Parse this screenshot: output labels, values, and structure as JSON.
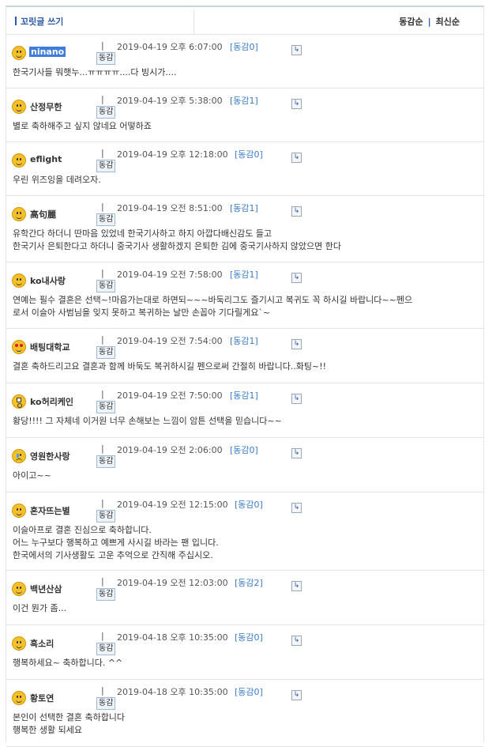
{
  "header": {
    "title": "꼬릿글 쓰기",
    "sort_by_votes": "동감순",
    "sort_by_latest": "최신순"
  },
  "vote_button_label": "동감",
  "reply_icon": "reply-arrow-icon",
  "comments": [
    {
      "nick": "ninano",
      "date": "2019-04-19 오후 6:07:00",
      "vote": "[동감0]",
      "text": "한국기사들 뭐햇누...ㅠㅠㅠㅠ....다 빙시가...."
    },
    {
      "nick": "산정무한",
      "date": "2019-04-19 오후 5:38:00",
      "vote": "[동감1]",
      "text": "별로 축하해주고 싶지 않네요 어떻하죠"
    },
    {
      "nick": "eflight",
      "date": "2019-04-19 오후 12:18:00",
      "vote": "[동감0]",
      "text": "우린 위즈잉을 데려오자."
    },
    {
      "nick": "高句麗",
      "date": "2019-04-19 오전 8:51:00",
      "vote": "[동감1]",
      "text": "유학간다 하더니 딴마음 있었네 한국기사하고 하지 아깝다배신감도 들고\n한국기사 은퇴한다고 하더니 중국기사 생활하겠지 은퇴한 김에 중국기사하지 않았으면 한다"
    },
    {
      "nick": "ko내사랑",
      "date": "2019-04-19 오전 7:58:00",
      "vote": "[동감1]",
      "text": "연예는 필수 결혼은 선택~!마음가는대로 하면되~~~바둑리그도 즐기시고 복귀도 꼭 하시길 바랍니다~~펜으\n로서 이슬아 사범님을 잊지 못하고 복귀하는 날만 손꼽아 기다릴게요`~"
    },
    {
      "nick": "배팅대학교",
      "date": "2019-04-19 오전 7:54:00",
      "vote": "[동감1]",
      "text": "결혼 축하드리고요 결혼과 함께 바둑도 복귀하시길 펜으로써 간절히 바랍니다..화팅~!!"
    },
    {
      "nick": "ko허리케인",
      "date": "2019-04-19 오전 7:50:00",
      "vote": "[동감1]",
      "text": "황당!!!! 그 자체네 이거원 너무 손해보는 느낌이 암튼 선택을 믿습니다~~"
    },
    {
      "nick": "영원한사랑",
      "date": "2019-04-19 오전 2:06:00",
      "vote": "[동감0]",
      "text": "아이고~~"
    },
    {
      "nick": "혼자뜨는별",
      "date": "2019-04-19 오전 12:15:00",
      "vote": "[동감0]",
      "text": "이슬아프로 결혼 진심으로 축하합니다.\n어느 누구보다 행복하고 예쁘게 사시길 바라는 팬 입니다.\n한국에서의 기사생활도 고운 추억으로 간직해 주십시오."
    },
    {
      "nick": "백년산삼",
      "date": "2019-04-19 오전 12:03:00",
      "vote": "[동감2]",
      "text": "이건 뭔가 좀..."
    },
    {
      "nick": "흑소리",
      "date": "2019-04-18 오후 10:35:00",
      "vote": "[동감0]",
      "text": "행복하세요~ 축하합니다. ^^"
    },
    {
      "nick": "황토연",
      "date": "2019-04-18 오후 10:35:00",
      "vote": "[동감0]",
      "text": "본인이 선택한 결혼 축하합니다\n행복한 생활 되세요"
    }
  ]
}
